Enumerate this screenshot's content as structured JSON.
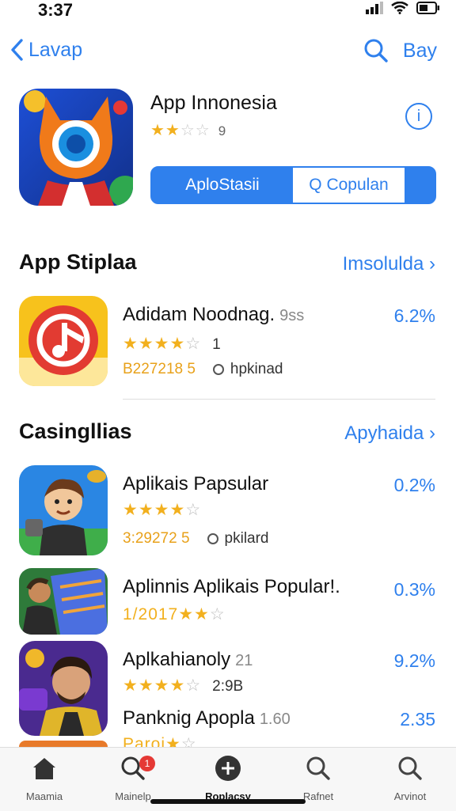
{
  "status": {
    "time": "3:37"
  },
  "nav": {
    "back_label": "Lavap",
    "right_label": "Bay"
  },
  "hero": {
    "title": "App Innonesia",
    "stars": "★★",
    "stars_empty": "☆☆",
    "rating_count": "9",
    "segment_active": "AploStasii",
    "segment_inactive": "Q Copulan",
    "info_glyph": "i"
  },
  "section1": {
    "title": "App Stiplaa",
    "link": "Imsolulda",
    "items": [
      {
        "name": "Adidam Noodnag.",
        "sub": "9ss",
        "stars": "★★★★",
        "stars_empty": "☆",
        "count": "1",
        "code": "B227218 5",
        "tag": "hpkinad",
        "pct": "6.2%"
      }
    ]
  },
  "section2": {
    "title": "Casingllias",
    "link": "Apyhaida",
    "items": [
      {
        "name": "Aplikais Papsular",
        "stars": "★★★★",
        "stars_empty": "☆",
        "code": "3:29272 5",
        "tag": "pkilard",
        "pct": "0.2%"
      },
      {
        "name": "Aplinnis Aplikais Popular!.",
        "stars": "1/2017★★",
        "stars_empty": "☆",
        "pct": "0.3%"
      },
      {
        "name": "Aplkahianoly",
        "sub": "21",
        "stars": "★★★★",
        "stars_empty": "☆",
        "count": "2:9B",
        "pct": "9.2%"
      },
      {
        "name": "Panknig Apopla",
        "sub": "1.60",
        "stars": "Paroi★",
        "stars_empty": "☆",
        "pct": "2.35"
      }
    ]
  },
  "tabs": [
    {
      "label": "Maamia",
      "icon": "home-icon"
    },
    {
      "label": "Mainelp",
      "icon": "search-icon",
      "badge": "1"
    },
    {
      "label": "Roplacsy",
      "icon": "plus-icon"
    },
    {
      "label": "Rafnet",
      "icon": "search-icon"
    },
    {
      "label": "Arvinot",
      "icon": "search-icon"
    }
  ],
  "colors": {
    "accent": "#2f80ed",
    "star": "#f2b01e",
    "badge": "#e53935"
  }
}
